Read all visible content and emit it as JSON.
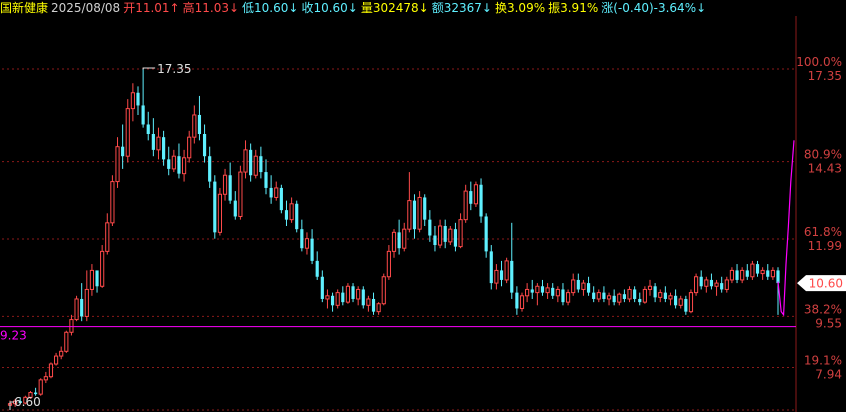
{
  "header": {
    "stock_name": "国新健康",
    "date": "2025/08/08",
    "open": "开11.01↑",
    "high": "高11.03↓",
    "low": "低10.60↓",
    "close": "收10.60↓",
    "volume": "量302478↓",
    "amount": "额32367↓",
    "turnover": "换3.09%",
    "amplitude": "振3.91%",
    "change": "涨(-0.40)-3.64%↓"
  },
  "colors": {
    "up": "#ff4a4a",
    "down": "#5ff0ff",
    "grid": "#8b1a1a",
    "accent_line": "#ff00ff",
    "label": "#d04040",
    "text": "#d0d0d0"
  },
  "chart_data": {
    "type": "candlestick",
    "ylim": [
      6.6,
      18.2
    ],
    "high_mark": "17.35",
    "low_mark": "6.60",
    "support_label": "9.23",
    "current_price": "10.60",
    "right_axis": [
      {
        "pct": "100.0%",
        "price": "17.35",
        "value": 17.35
      },
      {
        "pct": "80.9%",
        "price": "14.43",
        "value": 14.43
      },
      {
        "pct": "61.8%",
        "price": "11.99",
        "value": 11.99
      },
      {
        "pct": "38.2%",
        "price": "9.55",
        "value": 9.55
      },
      {
        "pct": "19.1%",
        "price": "7.94",
        "value": 7.94
      },
      {
        "pct": "",
        "price": "6.60",
        "value": 6.6
      }
    ],
    "support_value": 9.23,
    "candles": [
      [
        6.75,
        6.9,
        6.6,
        6.8
      ],
      [
        6.8,
        6.95,
        6.7,
        6.88
      ],
      [
        6.88,
        7.0,
        6.8,
        6.82
      ],
      [
        6.82,
        7.05,
        6.78,
        7.0
      ],
      [
        7.0,
        7.2,
        6.95,
        7.15
      ],
      [
        7.15,
        7.3,
        7.05,
        7.1
      ],
      [
        7.1,
        7.6,
        7.05,
        7.55
      ],
      [
        7.55,
        7.8,
        7.45,
        7.65
      ],
      [
        7.65,
        8.1,
        7.6,
        8.05
      ],
      [
        8.05,
        8.4,
        8.0,
        8.3
      ],
      [
        8.3,
        8.6,
        8.2,
        8.45
      ],
      [
        8.45,
        9.1,
        8.4,
        9.05
      ],
      [
        9.05,
        9.6,
        8.95,
        9.45
      ],
      [
        9.45,
        10.2,
        9.4,
        10.1
      ],
      [
        10.1,
        10.6,
        9.4,
        9.55
      ],
      [
        9.55,
        11.0,
        9.4,
        10.4
      ],
      [
        10.4,
        11.2,
        10.2,
        11.0
      ],
      [
        11.0,
        10.8,
        10.3,
        10.5
      ],
      [
        10.5,
        11.8,
        10.45,
        11.6
      ],
      [
        11.6,
        12.8,
        11.5,
        12.5
      ],
      [
        12.5,
        14.0,
        12.4,
        13.8
      ],
      [
        13.8,
        15.2,
        13.6,
        14.9
      ],
      [
        14.9,
        15.6,
        14.2,
        14.6
      ],
      [
        14.6,
        16.4,
        14.4,
        16.1
      ],
      [
        16.1,
        16.9,
        15.7,
        16.6
      ],
      [
        16.6,
        16.8,
        15.9,
        16.2
      ],
      [
        16.2,
        17.35,
        15.5,
        15.6
      ],
      [
        15.6,
        16.0,
        15.1,
        15.3
      ],
      [
        15.3,
        15.8,
        14.6,
        14.8
      ],
      [
        14.8,
        15.5,
        14.5,
        15.2
      ],
      [
        15.2,
        15.4,
        14.3,
        14.5
      ],
      [
        14.5,
        14.9,
        14.0,
        14.2
      ],
      [
        14.2,
        14.8,
        14.1,
        14.6
      ],
      [
        14.6,
        15.0,
        13.9,
        14.05
      ],
      [
        14.05,
        14.8,
        13.8,
        14.55
      ],
      [
        14.55,
        15.4,
        14.4,
        15.2
      ],
      [
        15.2,
        16.2,
        15.0,
        15.9
      ],
      [
        15.9,
        16.5,
        15.1,
        15.3
      ],
      [
        15.3,
        15.6,
        14.4,
        14.6
      ],
      [
        14.6,
        14.9,
        13.6,
        13.8
      ],
      [
        13.8,
        14.0,
        12.0,
        12.2
      ],
      [
        12.2,
        13.6,
        12.1,
        13.4
      ],
      [
        13.4,
        14.2,
        13.2,
        14.0
      ],
      [
        14.0,
        14.4,
        13.1,
        13.2
      ],
      [
        13.2,
        13.5,
        12.6,
        12.7
      ],
      [
        12.7,
        14.3,
        12.6,
        14.1
      ],
      [
        14.1,
        15.1,
        13.9,
        14.8
      ],
      [
        14.8,
        15.0,
        13.8,
        14.0
      ],
      [
        14.0,
        14.8,
        13.9,
        14.6
      ],
      [
        14.6,
        14.9,
        13.9,
        14.1
      ],
      [
        14.1,
        14.5,
        13.4,
        13.6
      ],
      [
        13.6,
        14.0,
        13.1,
        13.3
      ],
      [
        13.3,
        13.8,
        13.2,
        13.6
      ],
      [
        13.6,
        13.7,
        12.8,
        12.9
      ],
      [
        12.9,
        13.2,
        12.4,
        12.6
      ],
      [
        12.6,
        13.3,
        12.5,
        13.1
      ],
      [
        13.1,
        13.2,
        12.2,
        12.3
      ],
      [
        12.3,
        12.6,
        11.6,
        11.7
      ],
      [
        11.7,
        12.2,
        11.5,
        12.0
      ],
      [
        12.0,
        12.3,
        11.2,
        11.3
      ],
      [
        11.3,
        11.6,
        10.7,
        10.8
      ],
      [
        10.8,
        11.0,
        10.0,
        10.1
      ],
      [
        10.1,
        10.4,
        9.8,
        10.2
      ],
      [
        10.2,
        10.3,
        9.7,
        9.9
      ],
      [
        9.9,
        10.4,
        9.8,
        10.3
      ],
      [
        10.3,
        10.5,
        9.9,
        10.0
      ],
      [
        10.0,
        10.6,
        9.95,
        10.5
      ],
      [
        10.5,
        10.6,
        10.0,
        10.1
      ],
      [
        10.1,
        10.5,
        9.9,
        10.4
      ],
      [
        10.4,
        10.5,
        9.8,
        9.9
      ],
      [
        9.9,
        10.2,
        9.7,
        10.1
      ],
      [
        10.1,
        10.3,
        9.6,
        9.7
      ],
      [
        9.7,
        10.0,
        9.6,
        9.95
      ],
      [
        9.95,
        10.9,
        9.9,
        10.8
      ],
      [
        10.8,
        11.8,
        10.7,
        11.6
      ],
      [
        11.6,
        12.3,
        11.4,
        12.2
      ],
      [
        12.2,
        12.6,
        11.5,
        11.7
      ],
      [
        11.7,
        12.5,
        11.6,
        12.3
      ],
      [
        12.3,
        14.1,
        12.2,
        13.2
      ],
      [
        13.2,
        13.4,
        12.0,
        12.3
      ],
      [
        12.3,
        13.5,
        12.2,
        13.3
      ],
      [
        13.3,
        13.4,
        12.4,
        12.6
      ],
      [
        12.6,
        12.9,
        11.9,
        12.1
      ],
      [
        12.1,
        12.4,
        11.6,
        11.8
      ],
      [
        11.8,
        12.6,
        11.7,
        12.4
      ],
      [
        12.4,
        12.6,
        11.7,
        11.9
      ],
      [
        11.9,
        12.4,
        11.8,
        12.3
      ],
      [
        12.3,
        12.5,
        11.6,
        11.75
      ],
      [
        11.75,
        12.8,
        11.7,
        12.6
      ],
      [
        12.6,
        13.7,
        12.5,
        13.5
      ],
      [
        13.5,
        13.8,
        12.9,
        13.1
      ],
      [
        13.1,
        13.8,
        13.0,
        13.7
      ],
      [
        13.7,
        13.9,
        12.5,
        12.7
      ],
      [
        12.7,
        12.8,
        11.4,
        11.6
      ],
      [
        11.6,
        11.8,
        10.4,
        10.6
      ],
      [
        10.6,
        11.2,
        10.4,
        11.0
      ],
      [
        11.0,
        11.3,
        10.5,
        10.7
      ],
      [
        10.7,
        11.4,
        10.6,
        11.3
      ],
      [
        11.3,
        12.5,
        10.1,
        10.3
      ],
      [
        10.3,
        10.5,
        9.6,
        9.8
      ],
      [
        9.8,
        10.3,
        9.7,
        10.2
      ],
      [
        10.2,
        10.6,
        10.0,
        10.4
      ],
      [
        10.4,
        10.7,
        10.1,
        10.3
      ],
      [
        10.3,
        10.6,
        9.9,
        10.5
      ],
      [
        10.5,
        10.7,
        10.2,
        10.3
      ],
      [
        10.3,
        10.6,
        10.1,
        10.45
      ],
      [
        10.45,
        10.6,
        10.1,
        10.2
      ],
      [
        10.2,
        10.5,
        10.0,
        10.4
      ],
      [
        10.4,
        10.6,
        9.9,
        10.0
      ],
      [
        10.0,
        10.4,
        9.9,
        10.3
      ],
      [
        10.3,
        10.9,
        10.2,
        10.7
      ],
      [
        10.7,
        10.9,
        10.3,
        10.4
      ],
      [
        10.4,
        10.7,
        10.2,
        10.6
      ],
      [
        10.6,
        10.8,
        10.2,
        10.3
      ],
      [
        10.3,
        10.5,
        10.0,
        10.1
      ],
      [
        10.1,
        10.4,
        10.0,
        10.3
      ],
      [
        10.3,
        10.5,
        10.0,
        10.1
      ],
      [
        10.1,
        10.3,
        9.9,
        10.2
      ],
      [
        10.2,
        10.4,
        9.9,
        10.0
      ],
      [
        10.0,
        10.3,
        9.9,
        10.25
      ],
      [
        10.25,
        10.4,
        10.0,
        10.1
      ],
      [
        10.1,
        10.5,
        10.0,
        10.4
      ],
      [
        10.4,
        10.5,
        10.0,
        10.1
      ],
      [
        10.1,
        10.3,
        9.9,
        10.0
      ],
      [
        10.0,
        10.5,
        9.95,
        10.4
      ],
      [
        10.4,
        10.7,
        10.2,
        10.5
      ],
      [
        10.5,
        10.6,
        10.0,
        10.15
      ],
      [
        10.15,
        10.4,
        10.0,
        10.3
      ],
      [
        10.3,
        10.5,
        10.0,
        10.1
      ],
      [
        10.1,
        10.3,
        9.9,
        10.2
      ],
      [
        10.2,
        10.4,
        9.8,
        9.9
      ],
      [
        9.9,
        10.2,
        9.8,
        10.1
      ],
      [
        10.1,
        10.2,
        9.6,
        9.7
      ],
      [
        9.7,
        10.4,
        9.65,
        10.3
      ],
      [
        10.3,
        10.9,
        10.2,
        10.8
      ],
      [
        10.8,
        11.0,
        10.4,
        10.5
      ],
      [
        10.5,
        10.8,
        10.3,
        10.7
      ],
      [
        10.7,
        10.9,
        10.4,
        10.5
      ],
      [
        10.5,
        10.7,
        10.2,
        10.6
      ],
      [
        10.6,
        10.8,
        10.3,
        10.4
      ],
      [
        10.4,
        10.8,
        10.3,
        10.7
      ],
      [
        10.7,
        11.1,
        10.6,
        11.0
      ],
      [
        11.0,
        11.2,
        10.6,
        10.7
      ],
      [
        10.7,
        11.1,
        10.6,
        11.0
      ],
      [
        11.0,
        11.2,
        10.7,
        10.8
      ],
      [
        10.8,
        11.3,
        10.7,
        11.2
      ],
      [
        11.2,
        11.3,
        10.8,
        10.9
      ],
      [
        10.9,
        11.1,
        10.7,
        11.0
      ],
      [
        11.0,
        11.2,
        10.7,
        10.8
      ],
      [
        10.8,
        11.1,
        10.7,
        11.0
      ],
      [
        11.0,
        11.1,
        9.6,
        10.6
      ]
    ],
    "intraday_line": [
      [
        0.0,
        10.65
      ],
      [
        0.4,
        9.7
      ],
      [
        0.7,
        9.6
      ],
      [
        1.0,
        11.2
      ],
      [
        1.3,
        12.4
      ],
      [
        1.6,
        13.8
      ],
      [
        2.0,
        15.1
      ]
    ]
  }
}
